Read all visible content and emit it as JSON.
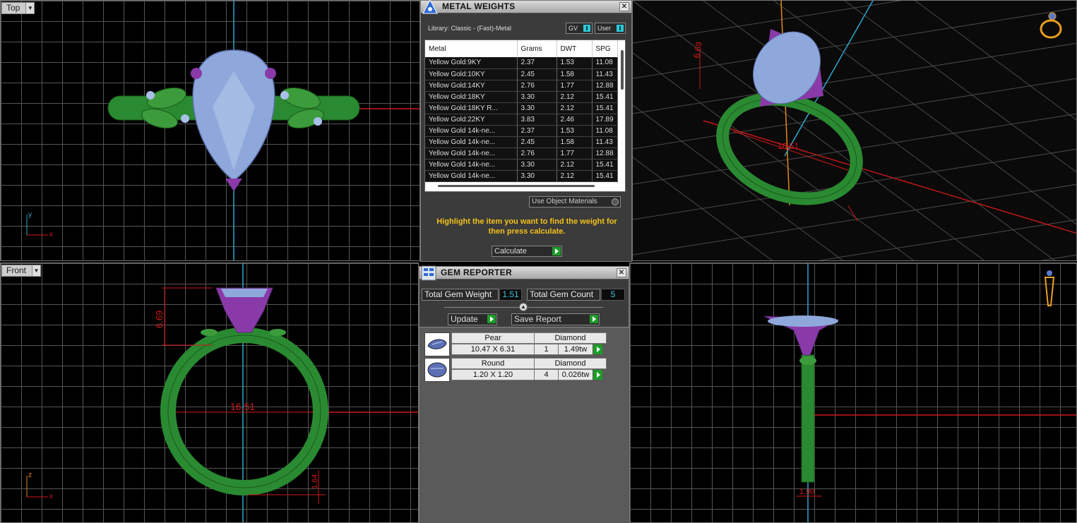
{
  "viewports": {
    "top": {
      "label": "Top"
    },
    "front": {
      "label": "Front",
      "dim_height": "6.69",
      "dim_width": "16.51",
      "dim_small": "1.64"
    },
    "perspective": {
      "dim_height": "6.69",
      "dim_width": "16.51"
    },
    "side": {
      "dim_small": "1.90"
    }
  },
  "axes": {
    "x": "x",
    "y": "y",
    "z": "z"
  },
  "metal_weights": {
    "title": "METAL WEIGHTS",
    "library_label": "Library: Classic - (Fast)-Metal",
    "gv_toggle": "GV",
    "user_toggle": "User",
    "columns": [
      "Metal",
      "Grams",
      "DWT",
      "SPG"
    ],
    "rows": [
      [
        "Yellow Gold:9KY",
        "2.37",
        "1.53",
        "11.08"
      ],
      [
        "Yellow Gold:10KY",
        "2.45",
        "1.58",
        "11.43"
      ],
      [
        "Yellow Gold:14KY",
        "2.76",
        "1.77",
        "12.88"
      ],
      [
        "Yellow Gold:18KY",
        "3.30",
        "2.12",
        "15.41"
      ],
      [
        "Yellow Gold:18KY R...",
        "3.30",
        "2.12",
        "15.41"
      ],
      [
        "Yellow Gold:22KY",
        "3.83",
        "2.46",
        "17.89"
      ],
      [
        "Yellow Gold 14k-ne...",
        "2.37",
        "1.53",
        "11.08"
      ],
      [
        "Yellow Gold 14k-ne...",
        "2.45",
        "1.58",
        "11.43"
      ],
      [
        "Yellow Gold 14k-ne...",
        "2.76",
        "1.77",
        "12.88"
      ],
      [
        "Yellow Gold 14k-ne...",
        "3.30",
        "2.12",
        "15.41"
      ],
      [
        "Yellow Gold 14k-ne...",
        "3.30",
        "2.12",
        "15.41"
      ]
    ],
    "use_object_materials": "Use Object Materials",
    "hint": "Highlight the item you want to find the weight for then press calculate.",
    "calculate_label": "Calculate"
  },
  "gem_reporter": {
    "title": "GEM REPORTER",
    "total_weight_label": "Total Gem Weight",
    "total_weight_value": "1.51",
    "total_count_label": "Total Gem Count",
    "total_count_value": "5",
    "update_label": "Update",
    "save_report_label": "Save Report",
    "gems": [
      {
        "shape": "Pear",
        "size": "10.47 X 6.31",
        "type": "Diamond",
        "qty": "1",
        "weight": "1.49tw"
      },
      {
        "shape": "Round",
        "size": "1.20 X 1.20",
        "type": "Diamond",
        "qty": "4",
        "weight": "0.026tw"
      }
    ]
  },
  "colors": {
    "metal": "#2a8a32",
    "prong": "#8a3aa8",
    "gem": "#8fa8dc",
    "dimension": "#e01818",
    "axis_blue": "#2ea6c8",
    "hint_text": "#f2c21b"
  }
}
